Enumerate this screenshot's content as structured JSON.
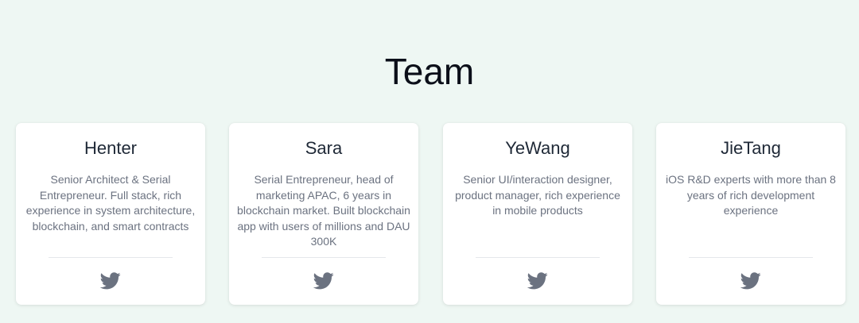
{
  "section": {
    "title": "Team"
  },
  "members": [
    {
      "name": "Henter",
      "bio": "Senior Architect & Serial Entrepreneur. Full stack, rich experience in system architecture, blockchain, and smart contracts",
      "social_icon": "twitter-icon"
    },
    {
      "name": "Sara",
      "bio": "Serial Entrepreneur, head of marketing APAC, 6 years in blockchain market. Built blockchain app with users of millions and DAU 300K",
      "social_icon": "twitter-icon"
    },
    {
      "name": "YeWang",
      "bio": "Senior UI/interaction designer, product manager, rich experience in mobile products",
      "social_icon": "twitter-icon"
    },
    {
      "name": "JieTang",
      "bio": "iOS R&D experts with more than 8 years of rich development experience",
      "social_icon": "twitter-icon"
    }
  ],
  "colors": {
    "background": "#eef7f3",
    "card": "#ffffff",
    "icon": "#6b7280"
  }
}
